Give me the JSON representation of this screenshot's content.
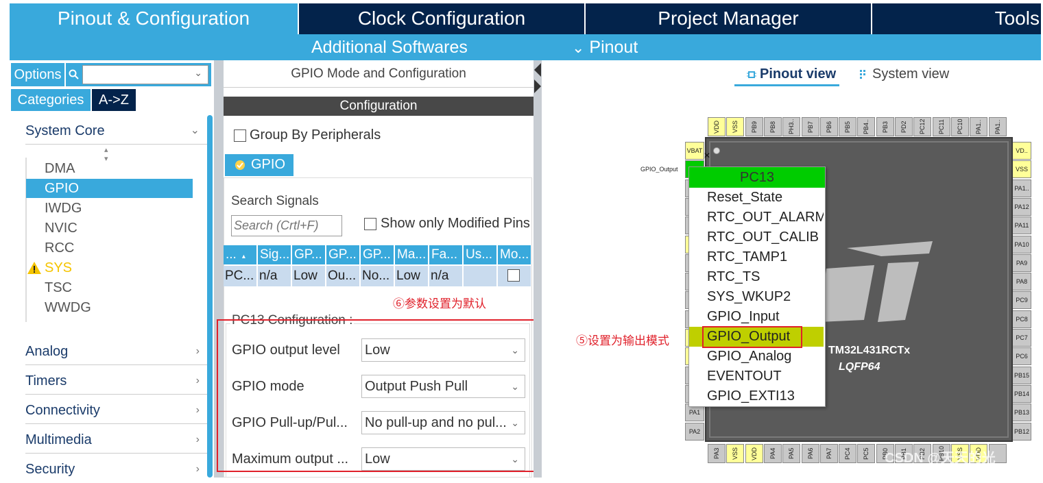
{
  "top_tabs": [
    "Pinout & Configuration",
    "Clock Configuration",
    "Project Manager",
    "Tools"
  ],
  "sub_nav": {
    "additional": "Additional Softwares",
    "pinout": "Pinout",
    "pinout_chevron": "⌄"
  },
  "left": {
    "options_label": "Options",
    "search_placeholder": "",
    "categories_tab": "Categories",
    "az_tab": "A->Z",
    "system_core": "System Core",
    "system_core_items": [
      "DMA",
      "GPIO",
      "IWDG",
      "NVIC",
      "RCC",
      "SYS",
      "TSC",
      "WWDG"
    ],
    "categories": [
      "Analog",
      "Timers",
      "Connectivity",
      "Multimedia",
      "Security"
    ]
  },
  "middle": {
    "header": "GPIO Mode and Configuration",
    "config_bar": "Configuration",
    "group_by": "Group By Peripherals",
    "gpio_tab": "GPIO",
    "search_signals": "Search Signals",
    "search_placeholder": "Search (Crtl+F)",
    "show_modified": "Show only Modified Pins",
    "table_headers": [
      "...",
      "Sig...",
      "GP...",
      "GP...",
      "GP...",
      "Ma...",
      "Fa...",
      "Us...",
      "Mo..."
    ],
    "table_row": [
      "PC...",
      "n/a",
      "Low",
      "Ou...",
      "No...",
      "Low",
      "n/a",
      "",
      ""
    ],
    "annotation6": "⑥参数设置为默认",
    "pc13_config_title": "PC13 Configuration :",
    "config_rows": [
      {
        "label": "GPIO output level",
        "value": "Low"
      },
      {
        "label": "GPIO mode",
        "value": "Output Push Pull"
      },
      {
        "label": "GPIO Pull-up/Pul...",
        "value": "No pull-up and no pul..."
      },
      {
        "label": "Maximum output ...",
        "value": "Low"
      }
    ]
  },
  "right": {
    "pinout_view": "Pinout view",
    "system_view": "System view",
    "top_pins": [
      "VDD",
      "VSS",
      "PB9",
      "PB8",
      "PH3..",
      "PB7",
      "PB6",
      "PB5",
      "PB4..",
      "PB3",
      "PD2",
      "PC12",
      "PC11",
      "PC10",
      "PA1..",
      "PA1.."
    ],
    "right_pins": [
      "VD..",
      "VSS",
      "PA1..",
      "PA12",
      "PA11",
      "PA10",
      "PA9",
      "PA8",
      "PC9",
      "PC8",
      "PC7",
      "PC6",
      "PB15",
      "PB14",
      "PB13",
      "PB12"
    ],
    "bottom_pins": [
      "PA3",
      "VSS",
      "VDD",
      "PA4",
      "PA5",
      "PA6",
      "PA7",
      "PC4",
      "PC5",
      "PB0",
      "PB1",
      "PB2",
      "PB10",
      "VSS",
      "VDD",
      ""
    ],
    "left_pins": [
      "VBAT",
      "",
      "",
      "",
      "",
      "",
      "",
      "",
      "",
      "",
      "",
      "",
      "",
      "",
      "PA1",
      "PA2"
    ],
    "gpio_output_label": "GPIO_Output",
    "chip_name": "STM32L431RCTx",
    "chip_name_visible": "TM32L431RCTx",
    "package": "LQFP64",
    "menu_title": "PC13",
    "menu_items": [
      "Reset_State",
      "RTC_OUT_ALARM",
      "RTC_OUT_CALIB",
      "RTC_TAMP1",
      "RTC_TS",
      "SYS_WKUP2",
      "GPIO_Input",
      "GPIO_Output",
      "GPIO_Analog",
      "EVENTOUT",
      "GPIO_EXTI13"
    ],
    "annotation5": "⑤设置为输出模式",
    "watermark": "CSDN @天天的光"
  },
  "colors": {
    "navy": "#03234b",
    "blue": "#39a9dc",
    "menu_green": "#00cc00",
    "menu_highlight": "#bfcf00",
    "annotation_red": "#e0202a",
    "warning": "#f5c400"
  }
}
